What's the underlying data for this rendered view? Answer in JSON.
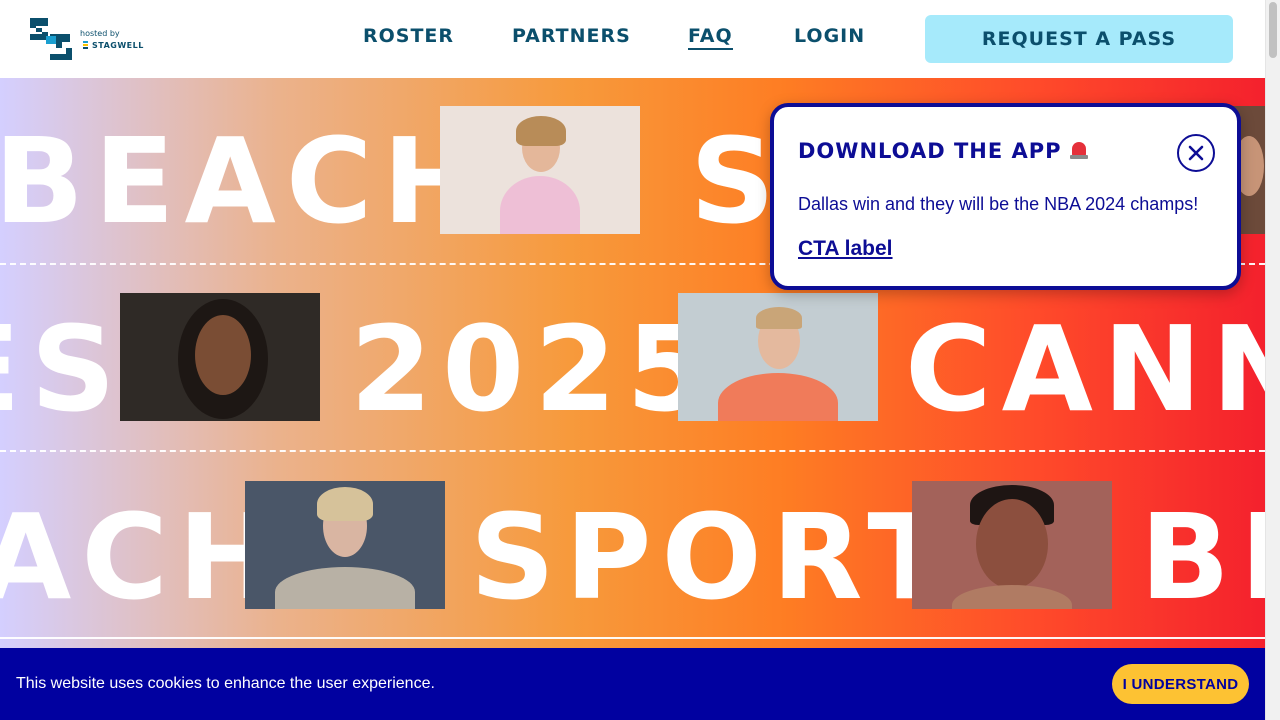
{
  "header": {
    "logo_icon": "sb-monogram-logo",
    "hosted_by": "hosted by",
    "hosted_brand": "STAGWELL",
    "nav": [
      {
        "label": "ROSTER",
        "active": false
      },
      {
        "label": "PARTNERS",
        "active": false
      },
      {
        "label": "FAQ",
        "active": true
      },
      {
        "label": "LOGIN",
        "active": false
      }
    ],
    "cta_label": "REQUEST A PASS"
  },
  "hero": {
    "row1": [
      "BEACH",
      "S"
    ],
    "row2": [
      "ES",
      "2025",
      "CANN"
    ],
    "row3": [
      "ACH",
      "SPORT",
      "BE"
    ],
    "photos": [
      "woman-pink-blazer-photo",
      "man-portrait-photo",
      "woman-braids-photo",
      "goalkeeper-photo",
      "woman-blonde-photo",
      "man-smiling-photo"
    ]
  },
  "popup": {
    "title": "DOWNLOAD THE APP",
    "title_icon": "siren-emoji",
    "body": "Dallas win and they will be the NBA 2024 champs!",
    "link_label": "CTA label",
    "close_icon": "close-circle-icon"
  },
  "cookie": {
    "text": "This website uses cookies to enhance the user experience.",
    "button_label": "I UNDERSTAND"
  },
  "colors": {
    "brand_dark": "#0b4f6c",
    "cta_bg": "#a6eafb",
    "popup_navy": "#0d0d95",
    "cookie_bg": "#0101a0",
    "cookie_button": "#fdc233"
  }
}
